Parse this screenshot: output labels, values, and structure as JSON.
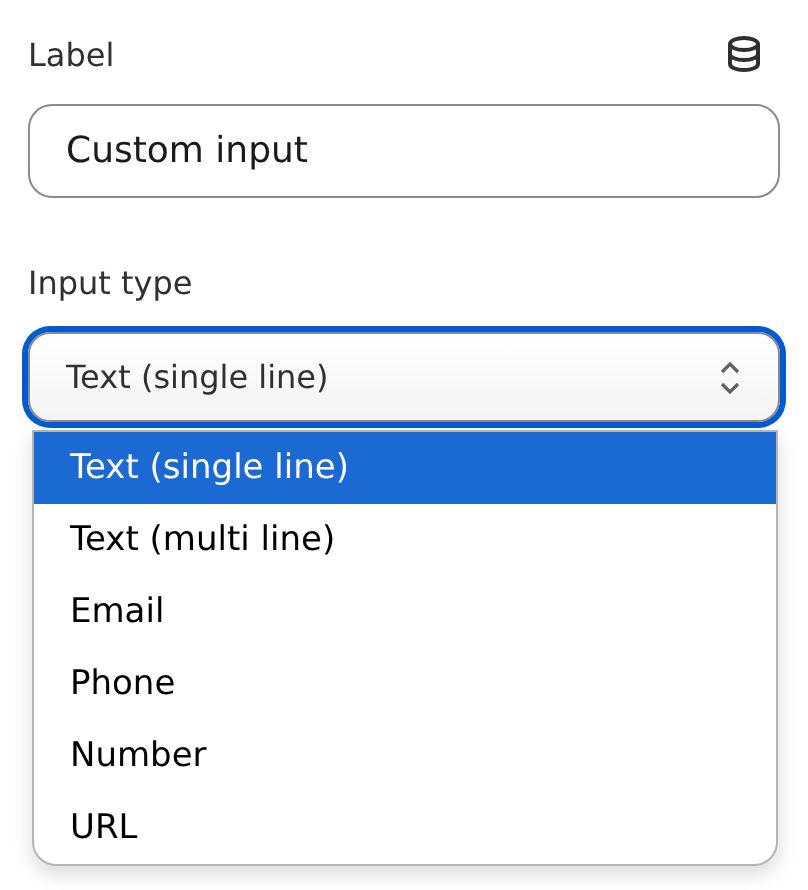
{
  "label_field": {
    "label": "Label",
    "value": "Custom input"
  },
  "input_type": {
    "label": "Input type",
    "value": "Text (single line)",
    "focused": true,
    "options": [
      {
        "label": "Text (single line)",
        "selected": true
      },
      {
        "label": "Text (multi line)",
        "selected": false
      },
      {
        "label": "Email",
        "selected": false
      },
      {
        "label": "Phone",
        "selected": false
      },
      {
        "label": "Number",
        "selected": false
      },
      {
        "label": "URL",
        "selected": false
      }
    ]
  }
}
